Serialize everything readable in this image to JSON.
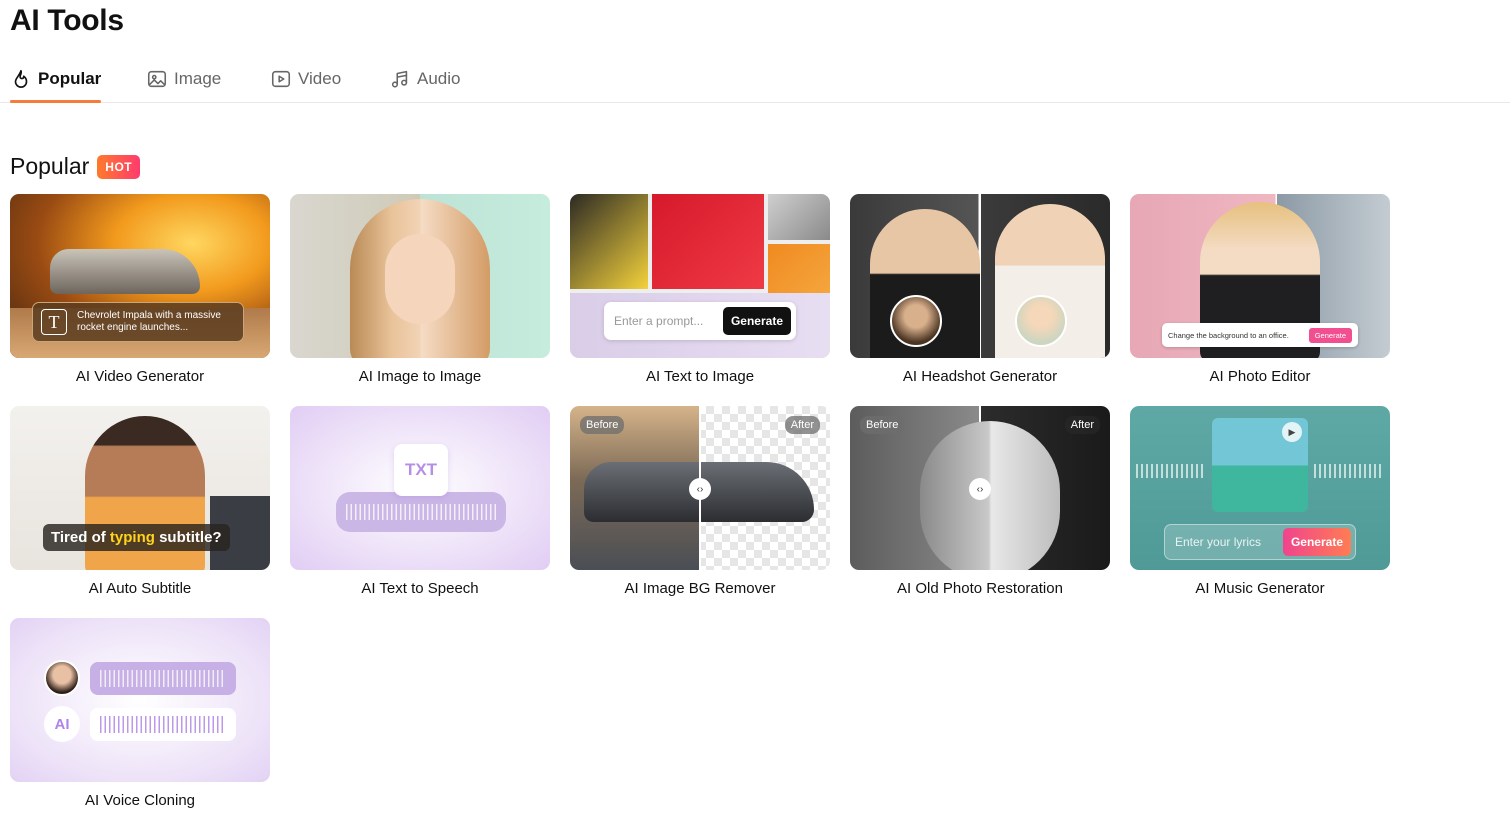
{
  "page": {
    "title": "AI Tools"
  },
  "tabs": [
    {
      "label": "Popular",
      "icon": "flame-icon",
      "active": true
    },
    {
      "label": "Image",
      "icon": "image-icon",
      "active": false
    },
    {
      "label": "Video",
      "icon": "video-play-icon",
      "active": false
    },
    {
      "label": "Audio",
      "icon": "music-note-icon",
      "active": false
    }
  ],
  "section": {
    "title": "Popular",
    "badge": "HOT"
  },
  "colors": {
    "accent": "#f77b3a",
    "hot_badge_start": "#ff7a2c",
    "hot_badge_end": "#ff3b6e"
  },
  "cards": [
    {
      "label": "AI Video Generator",
      "prompt_text": "Chevrolet Impala with a massive rocket engine launches...",
      "prompt_icon": "T"
    },
    {
      "label": "AI Image to Image"
    },
    {
      "label": "AI Text to Image",
      "prompt_placeholder": "Enter a prompt...",
      "generate_label": "Generate"
    },
    {
      "label": "AI Headshot Generator"
    },
    {
      "label": "AI Photo Editor",
      "prompt_text": "Change the background to an office.",
      "generate_label": "Generate"
    },
    {
      "label": "AI Auto Subtitle",
      "subtitle_pre": "Tired of ",
      "subtitle_highlight": "typing",
      "subtitle_post": " subtitle?"
    },
    {
      "label": "AI Text to Speech",
      "doc_label": "TXT"
    },
    {
      "label": "AI Image BG Remover",
      "before_label": "Before",
      "after_label": "After"
    },
    {
      "label": "AI Old Photo Restoration",
      "before_label": "Before",
      "after_label": "After"
    },
    {
      "label": "AI Music Generator",
      "lyrics_placeholder": "Enter your lyrics",
      "generate_label": "Generate"
    },
    {
      "label": "AI Voice Cloning",
      "ai_label": "AI"
    }
  ]
}
